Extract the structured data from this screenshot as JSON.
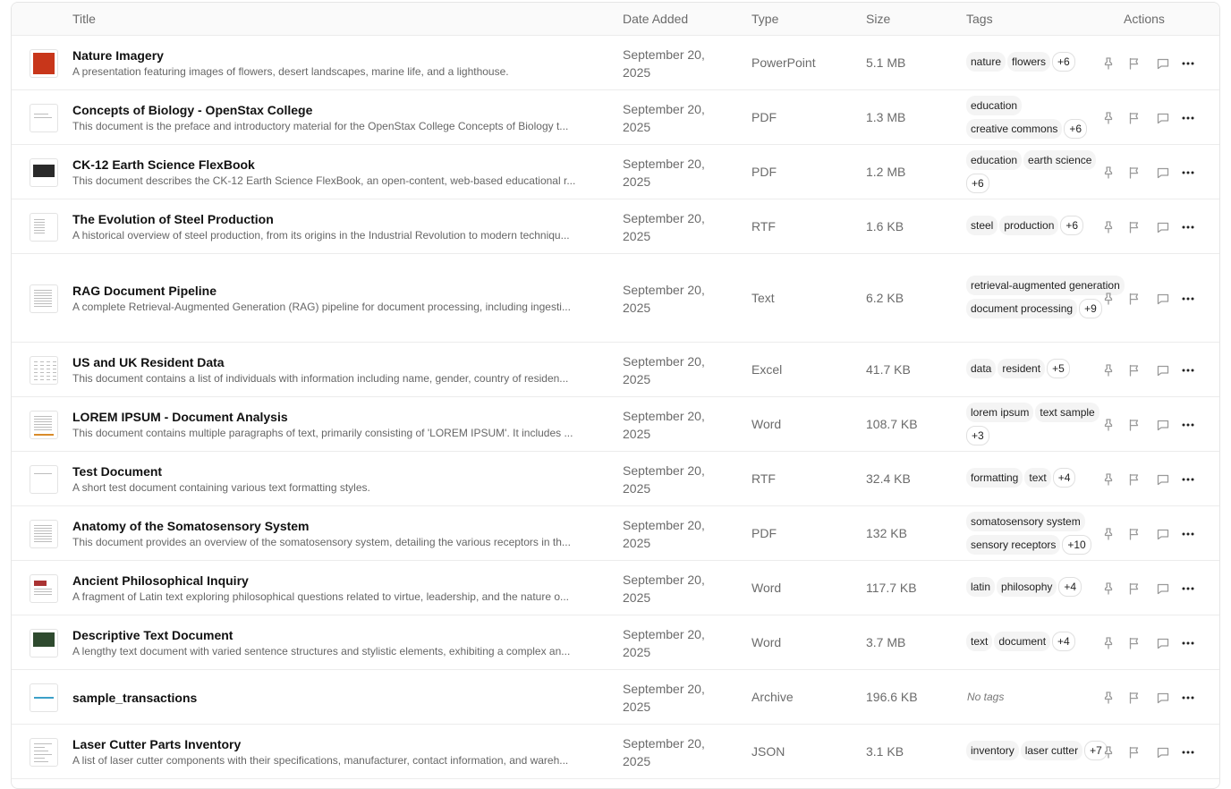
{
  "headers": {
    "title": "Title",
    "date": "Date Added",
    "type": "Type",
    "size": "Size",
    "tags": "Tags",
    "actions": "Actions"
  },
  "no_tags_label": "No tags",
  "icons": {
    "pin": "pin-icon",
    "flag": "flag-icon",
    "comment": "comment-icon",
    "more": "more-horizontal-icon"
  },
  "rows": [
    {
      "title": "Nature Imagery",
      "desc": "A presentation featuring images of flowers, desert landscapes, marine life, and a lighthouse.",
      "date_line1": "September 20,",
      "date_line2": "2025",
      "type": "PowerPoint",
      "size": "5.1 MB",
      "tags": [
        "nature",
        "flowers"
      ],
      "more": "+6"
    },
    {
      "title": "Concepts of Biology - OpenStax College",
      "desc": "This document is the preface and introductory material for the OpenStax College Concepts of Biology t...",
      "date_line1": "September 20,",
      "date_line2": "2025",
      "type": "PDF",
      "size": "1.3 MB",
      "tags": [
        "education",
        "creative commons"
      ],
      "more": "+6"
    },
    {
      "title": "CK-12 Earth Science FlexBook",
      "desc": "This document describes the CK-12 Earth Science FlexBook, an open-content, web-based educational r...",
      "date_line1": "September 20,",
      "date_line2": "2025",
      "type": "PDF",
      "size": "1.2 MB",
      "tags": [
        "education",
        "earth science"
      ],
      "more": "+6"
    },
    {
      "title": "The Evolution of Steel Production",
      "desc": "A historical overview of steel production, from its origins in the Industrial Revolution to modern techniqu...",
      "date_line1": "September 20,",
      "date_line2": "2025",
      "type": "RTF",
      "size": "1.6 KB",
      "tags": [
        "steel",
        "production"
      ],
      "more": "+6"
    },
    {
      "title": "RAG Document Pipeline",
      "desc": "A complete Retrieval-Augmented Generation (RAG) pipeline for document processing, including ingesti...",
      "date_line1": "September 20,",
      "date_line2": "2025",
      "type": "Text",
      "size": "6.2 KB",
      "tags": [
        "retrieval-augmented generation",
        "document processing"
      ],
      "more": "+9"
    },
    {
      "title": "US and UK Resident Data",
      "desc": "This document contains a list of individuals with information including name, gender, country of residen...",
      "date_line1": "September 20,",
      "date_line2": "2025",
      "type": "Excel",
      "size": "41.7 KB",
      "tags": [
        "data",
        "resident"
      ],
      "more": "+5"
    },
    {
      "title": "LOREM IPSUM - Document Analysis",
      "desc": "This document contains multiple paragraphs of text, primarily consisting of 'LOREM IPSUM'. It includes ...",
      "date_line1": "September 20,",
      "date_line2": "2025",
      "type": "Word",
      "size": "108.7 KB",
      "tags": [
        "lorem ipsum",
        "text sample"
      ],
      "more": "+3"
    },
    {
      "title": "Test Document",
      "desc": "A short test document containing various text formatting styles.",
      "date_line1": "September 20,",
      "date_line2": "2025",
      "type": "RTF",
      "size": "32.4 KB",
      "tags": [
        "formatting",
        "text"
      ],
      "more": "+4"
    },
    {
      "title": "Anatomy of the Somatosensory System",
      "desc": "This document provides an overview of the somatosensory system, detailing the various receptors in th...",
      "date_line1": "September 20,",
      "date_line2": "2025",
      "type": "PDF",
      "size": "132 KB",
      "tags": [
        "somatosensory system",
        "sensory receptors"
      ],
      "more": "+10"
    },
    {
      "title": "Ancient Philosophical Inquiry",
      "desc": "A fragment of Latin text exploring philosophical questions related to virtue, leadership, and the nature o...",
      "date_line1": "September 20,",
      "date_line2": "2025",
      "type": "Word",
      "size": "117.7 KB",
      "tags": [
        "latin",
        "philosophy"
      ],
      "more": "+4"
    },
    {
      "title": "Descriptive Text Document",
      "desc": "A lengthy text document with varied sentence structures and stylistic elements, exhibiting a complex an...",
      "date_line1": "September 20,",
      "date_line2": "2025",
      "type": "Word",
      "size": "3.7 MB",
      "tags": [
        "text",
        "document"
      ],
      "more": "+4"
    },
    {
      "title": "sample_transactions",
      "desc": "",
      "date_line1": "September 20,",
      "date_line2": "2025",
      "type": "Archive",
      "size": "196.6 KB",
      "tags": [],
      "more": ""
    },
    {
      "title": "Laser Cutter Parts Inventory",
      "desc": "A list of laser cutter components with their specifications, manufacturer, contact information, and wareh...",
      "date_line1": "September 20,",
      "date_line2": "2025",
      "type": "JSON",
      "size": "3.1 KB",
      "tags": [
        "inventory",
        "laser cutter"
      ],
      "more": "+7"
    }
  ]
}
